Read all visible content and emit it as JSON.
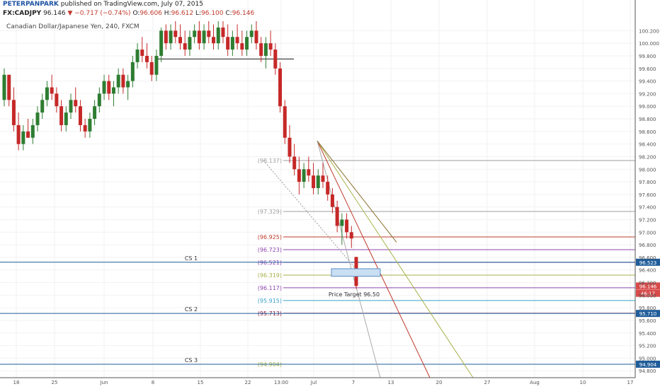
{
  "header": {
    "author": "PETERPANPARK",
    "published": "published on TradingView.com, July 07, 2015",
    "symbol": "FX:CADJPY",
    "price": "96.146",
    "change": "▼ −0.717 (−0.74%)",
    "o_label": "O:",
    "o_value": "96.606",
    "h_label": "H:",
    "h_value": "96.612",
    "l_label": "L:",
    "l_value": "96.100",
    "c_label": "C:",
    "c_value": "96.146",
    "series_title": "Canadian Dollar/Japanese Yen, 240, FXCM"
  },
  "chart_data": {
    "type": "candlestick",
    "title": "Canadian Dollar/Japanese Yen, 240, FXCM",
    "xlabel": "",
    "ylabel": "",
    "ylim": [
      94.69,
      100.35
    ],
    "y_ticks": [
      "100.200",
      "100.000",
      "99.800",
      "99.600",
      "99.400",
      "99.200",
      "99.000",
      "98.800",
      "98.600",
      "98.400",
      "98.200",
      "98.000",
      "97.800",
      "97.600",
      "97.400",
      "97.200",
      "97.000",
      "96.800",
      "96.600",
      "96.400",
      "96.200",
      "96.000",
      "95.800",
      "95.600",
      "95.400",
      "95.200",
      "95.000",
      "94.800"
    ],
    "x_ticks": [
      "18",
      "25",
      "Jun",
      "8",
      "15",
      "22",
      "13:00",
      "Jul",
      "7",
      "13",
      "20",
      "27",
      "Aug",
      "10",
      "17"
    ],
    "horizontal_levels": [
      {
        "label": "(98.137)",
        "value": 98.137,
        "color": "#9e9e9e"
      },
      {
        "label": "(97.329)",
        "value": 97.329,
        "color": "#9e9e9e"
      },
      {
        "label": "(96.925)",
        "value": 96.925,
        "color": "#c0392b"
      },
      {
        "label": "(96.723)",
        "value": 96.723,
        "color": "#8e44ad"
      },
      {
        "label": "(96.521)",
        "value": 96.521,
        "color": "#8e44ad"
      },
      {
        "label": "(96.319)",
        "value": 96.319,
        "color": "#a8b24a"
      },
      {
        "label": "(96.117)",
        "value": 96.117,
        "color": "#8e44ad"
      },
      {
        "label": "(95.915)",
        "value": 95.915,
        "color": "#3aa1c9"
      },
      {
        "label": "(95.713)",
        "value": 95.713,
        "color": "#8e1b3a"
      },
      {
        "label": "(94.904)",
        "value": 94.904,
        "color": "#a8b24a"
      }
    ],
    "support_levels": [
      {
        "label": "CS 1",
        "value": 96.523,
        "price_tag": "96.523",
        "color": "#1f5c99"
      },
      {
        "label": "CS 2",
        "value": 95.71,
        "price_tag": "95.710",
        "color": "#1f5c99"
      },
      {
        "label": "CS 3",
        "value": 94.904,
        "price_tag": "94.904",
        "color": "#1f5c99"
      }
    ],
    "resistance_line": 99.75,
    "price_tags": [
      {
        "text": "96.146",
        "value": 96.146,
        "color": "#d84a4a"
      },
      {
        "text": "46:17",
        "value": 96.03,
        "color": "#d84a4a"
      }
    ],
    "annotation": "Price Target 96.50",
    "target_box": [
      96.42,
      96.3
    ],
    "candles": [
      [
        99.1,
        99.6,
        99.0,
        99.5
      ],
      [
        99.5,
        99.5,
        99.0,
        99.1
      ],
      [
        99.1,
        99.3,
        98.6,
        98.7
      ],
      [
        98.7,
        98.9,
        98.3,
        98.4
      ],
      [
        98.4,
        98.7,
        98.3,
        98.6
      ],
      [
        98.6,
        98.8,
        98.5,
        98.5
      ],
      [
        98.5,
        98.8,
        98.4,
        98.7
      ],
      [
        98.7,
        99.0,
        98.6,
        98.9
      ],
      [
        98.9,
        99.2,
        98.8,
        99.1
      ],
      [
        99.1,
        99.4,
        99.0,
        99.3
      ],
      [
        99.3,
        99.5,
        99.1,
        99.2
      ],
      [
        99.2,
        99.3,
        98.9,
        99.0
      ],
      [
        99.0,
        99.1,
        98.6,
        98.7
      ],
      [
        98.7,
        99.0,
        98.6,
        98.9
      ],
      [
        98.9,
        99.2,
        98.8,
        99.1
      ],
      [
        99.1,
        99.3,
        98.9,
        99.0
      ],
      [
        99.0,
        99.1,
        98.6,
        98.7
      ],
      [
        98.7,
        98.8,
        98.5,
        98.6
      ],
      [
        98.6,
        98.9,
        98.5,
        98.8
      ],
      [
        98.8,
        99.1,
        98.7,
        99.0
      ],
      [
        99.0,
        99.3,
        98.9,
        99.2
      ],
      [
        99.2,
        99.5,
        99.1,
        99.4
      ],
      [
        99.4,
        99.5,
        99.1,
        99.2
      ],
      [
        99.2,
        99.4,
        99.0,
        99.3
      ],
      [
        99.3,
        99.6,
        99.2,
        99.5
      ],
      [
        99.5,
        99.6,
        99.2,
        99.3
      ],
      [
        99.3,
        99.5,
        99.1,
        99.4
      ],
      [
        99.4,
        99.8,
        99.3,
        99.7
      ],
      [
        99.7,
        100.0,
        99.6,
        99.9
      ],
      [
        99.9,
        100.1,
        99.7,
        99.8
      ],
      [
        99.8,
        100.0,
        99.6,
        99.7
      ],
      [
        99.7,
        99.8,
        99.4,
        99.5
      ],
      [
        99.5,
        99.9,
        99.4,
        99.8
      ],
      [
        99.8,
        100.25,
        99.7,
        100.2
      ],
      [
        100.2,
        100.3,
        99.9,
        100.0
      ],
      [
        100.0,
        100.3,
        99.9,
        100.2
      ],
      [
        100.2,
        100.35,
        100.0,
        100.1
      ],
      [
        100.1,
        100.3,
        99.9,
        100.0
      ],
      [
        100.0,
        100.2,
        99.8,
        99.9
      ],
      [
        99.9,
        100.2,
        99.8,
        100.1
      ],
      [
        100.1,
        100.3,
        100.0,
        100.2
      ],
      [
        100.2,
        100.35,
        99.9,
        100.0
      ],
      [
        100.0,
        100.3,
        99.9,
        100.2
      ],
      [
        100.2,
        100.35,
        100.0,
        100.1
      ],
      [
        100.1,
        100.3,
        99.9,
        100.0
      ],
      [
        100.0,
        100.35,
        99.9,
        100.25
      ],
      [
        100.25,
        100.35,
        100.0,
        100.1
      ],
      [
        100.1,
        100.3,
        99.8,
        99.9
      ],
      [
        99.9,
        100.2,
        99.8,
        100.1
      ],
      [
        100.1,
        100.3,
        99.9,
        100.0
      ],
      [
        100.0,
        100.2,
        99.8,
        99.9
      ],
      [
        99.9,
        100.2,
        99.8,
        100.1
      ],
      [
        100.1,
        100.3,
        100.0,
        100.2
      ],
      [
        100.2,
        100.35,
        99.9,
        100.0
      ],
      [
        100.0,
        100.1,
        99.7,
        99.8
      ],
      [
        99.8,
        100.1,
        99.6,
        100.0
      ],
      [
        100.0,
        100.2,
        99.8,
        99.9
      ],
      [
        99.9,
        100.0,
        99.5,
        99.6
      ],
      [
        99.6,
        99.7,
        98.9,
        99.0
      ],
      [
        99.0,
        99.1,
        98.4,
        98.5
      ],
      [
        98.5,
        98.7,
        98.1,
        98.2
      ],
      [
        98.2,
        98.4,
        97.9,
        98.0
      ],
      [
        98.0,
        98.2,
        97.6,
        97.8
      ],
      [
        97.8,
        98.1,
        97.7,
        98.0
      ],
      [
        98.0,
        98.2,
        97.8,
        97.9
      ],
      [
        97.9,
        98.1,
        97.6,
        97.7
      ],
      [
        97.7,
        98.0,
        97.6,
        97.9
      ],
      [
        97.9,
        98.1,
        97.7,
        97.8
      ],
      [
        97.8,
        97.9,
        97.5,
        97.6
      ],
      [
        97.6,
        97.7,
        97.3,
        97.4
      ],
      [
        97.4,
        97.5,
        97.0,
        97.1
      ],
      [
        97.1,
        97.3,
        96.8,
        97.2
      ],
      [
        97.2,
        97.3,
        96.9,
        97.0
      ],
      [
        97.0,
        97.1,
        96.75,
        96.9
      ],
      [
        96.606,
        96.612,
        96.1,
        96.146
      ]
    ]
  }
}
